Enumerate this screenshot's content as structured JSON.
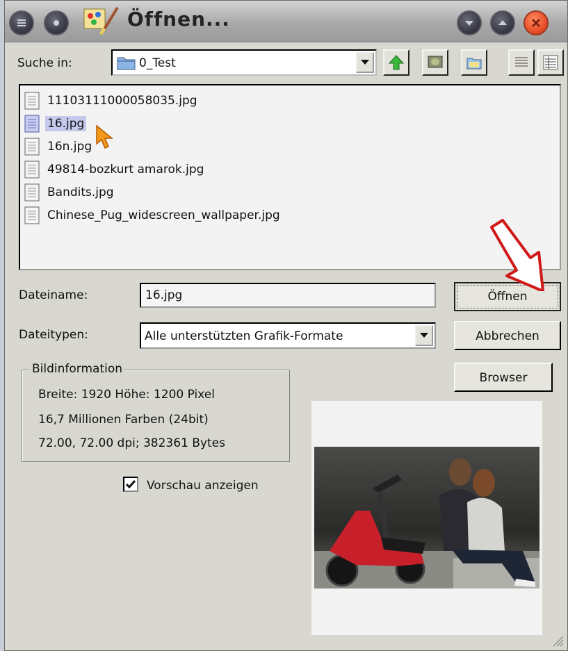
{
  "window": {
    "title": "Öffnen..."
  },
  "toolbar": {
    "look_in_label": "Suche in:",
    "look_in_value": "0_Test"
  },
  "files": [
    {
      "name": "11103111000058035.jpg",
      "selected": false
    },
    {
      "name": "16.jpg",
      "selected": true
    },
    {
      "name": "16n.jpg",
      "selected": false
    },
    {
      "name": "49814-bozkurt amarok.jpg",
      "selected": false
    },
    {
      "name": "Bandits.jpg",
      "selected": false
    },
    {
      "name": "Chinese_Pug_widescreen_wallpaper.jpg",
      "selected": false
    }
  ],
  "form": {
    "filename_label": "Dateiname:",
    "filename_value": "16.jpg",
    "filetype_label": "Dateitypen:",
    "filetype_value": "Alle unterstützten Grafik-Formate"
  },
  "buttons": {
    "open": "Öffnen",
    "cancel": "Abbrechen",
    "browser": "Browser"
  },
  "image_info": {
    "legend": "Bildinformation",
    "dimensions": "Breite: 1920  Höhe: 1200 Pixel",
    "colors": "16,7 Millionen Farben (24bit)",
    "resolution": "72.00, 72.00 dpi;  382361 Bytes"
  },
  "preview": {
    "checkbox_label": "Vorschau anzeigen",
    "checked": true
  },
  "colors": {
    "window_bg": "#d9d8d0",
    "selection": "#c5c9ec",
    "close_button": "#e8502a",
    "annotation_arrow": "#d01818",
    "cursor": "#f39a1c"
  }
}
